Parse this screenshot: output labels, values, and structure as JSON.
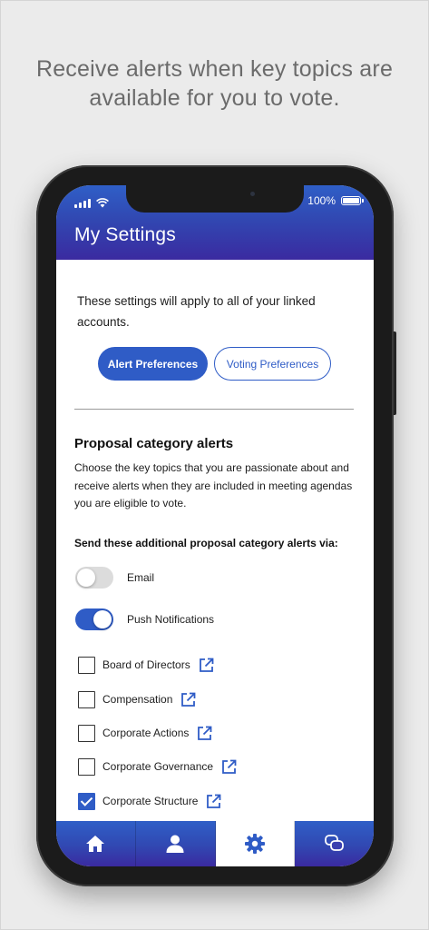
{
  "headline": "Receive alerts when key topics are available for you to vote.",
  "status_bar": {
    "battery": "100%"
  },
  "screen": {
    "title": "My Settings",
    "intro": "These settings will apply to all of your linked accounts.",
    "tabs": [
      {
        "label": "Alert Preferences",
        "active": true
      },
      {
        "label": "Voting Preferences",
        "active": false
      }
    ],
    "section": {
      "title": "Proposal category alerts",
      "description": "Choose the key topics that you are passionate about and receive alerts when they are included in meeting agendas you are eligible to vote.",
      "via_label": "Send these additional proposal category alerts via:"
    },
    "channels": [
      {
        "label": "Email",
        "enabled": false
      },
      {
        "label": "Push Notifications",
        "enabled": true
      }
    ],
    "categories": [
      {
        "label": "Board of Directors",
        "checked": false
      },
      {
        "label": "Compensation",
        "checked": false
      },
      {
        "label": "Corporate Actions",
        "checked": false
      },
      {
        "label": "Corporate Governance",
        "checked": false
      },
      {
        "label": "Corporate Structure",
        "checked": true
      }
    ]
  },
  "tabbar": {
    "items": [
      {
        "icon": "home-icon",
        "active": false
      },
      {
        "icon": "user-icon",
        "active": false
      },
      {
        "icon": "gear-icon",
        "active": true
      },
      {
        "icon": "chat-icon",
        "active": false
      }
    ]
  },
  "colors": {
    "accent": "#2f5cc6",
    "header_start": "#2f5fc7",
    "header_end": "#3a2aa0",
    "background": "#ebebeb",
    "headline_text": "#6b6b6b"
  }
}
